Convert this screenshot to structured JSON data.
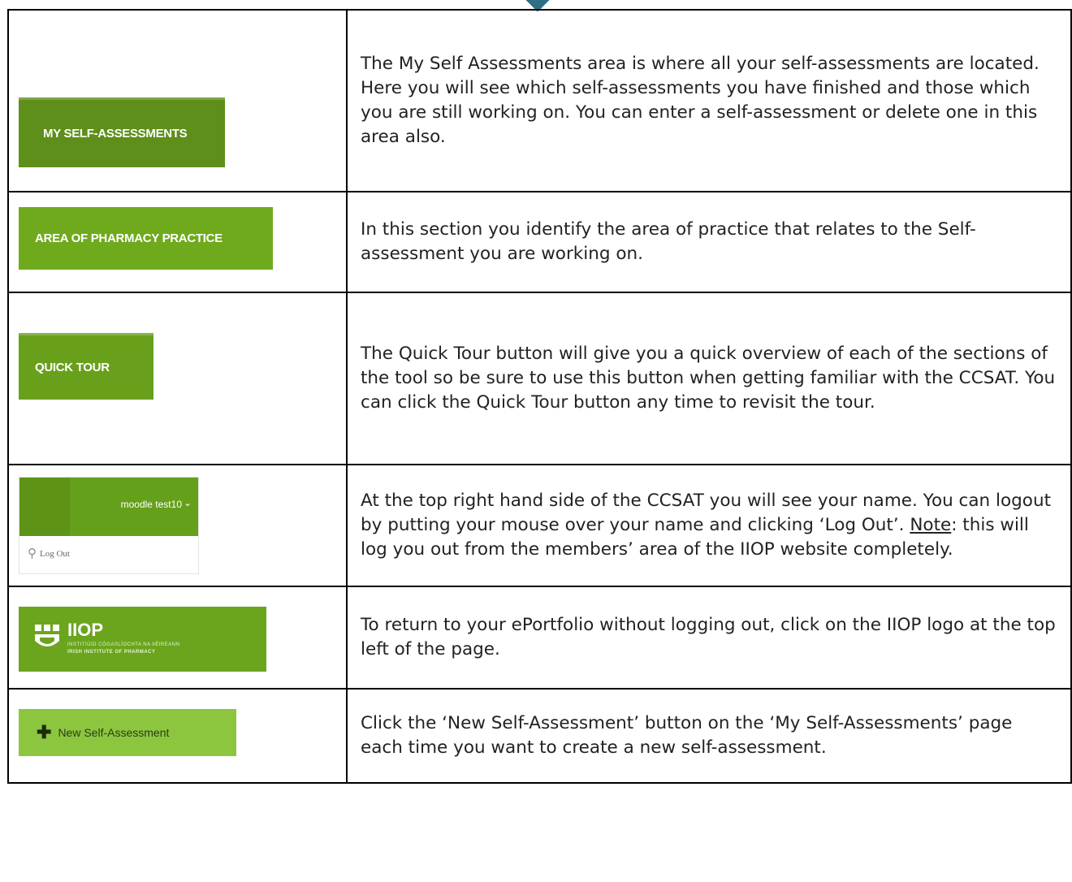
{
  "rows": [
    {
      "button_label": "MY SELF-ASSESSMENTS",
      "description": "The My Self Assessments area is where all your self-assessments are located. Here you will see which self-assessments you have finished and those which you are still working on. You can enter a self-assessment or delete one in this area also."
    },
    {
      "button_label": "AREA OF PHARMACY PRACTICE",
      "description": "In this section you identify the area of practice that relates to the Self-assessment you are working on."
    },
    {
      "button_label": "QUICK TOUR",
      "description": "The Quick Tour button will give you a quick overview of each of the sections of the tool so be sure to use this button when getting familiar with the CCSAT.  You can click the Quick Tour button any time to revisit the tour."
    },
    {
      "username": "moodle test10",
      "chevron_icon": "chevron-down-icon",
      "logout_icon": "key-icon",
      "logout_label": "Log Out",
      "description": "At the top right hand side of the CCSAT you will see your name. You can logout by putting your mouse over your name and clicking ‘Log Out’.",
      "note_label": "Note",
      "note_text": ": this will log you out from the members’ area of the IIOP website completely."
    },
    {
      "logo_text": "IIOP",
      "logo_sub1": "INSTITIÚID CÓGASLÍOCHTA NA hÉIREANN",
      "logo_sub2": "IRISH INSTITUTE OF PHARMACY",
      "description": "To return to your ePortfolio without logging out, click on the IIOP logo at the top left of the page."
    },
    {
      "button_icon": "plus-icon",
      "button_label": "New Self-Assessment",
      "description": "Click the ‘New Self-Assessment’ button on the ‘My Self-Assessments’ page each time you want to create a new self-assessment."
    }
  ],
  "colors": {
    "accent_green": "#6aa51d",
    "dark_green": "#5e8f1a",
    "light_green": "#8cc63f",
    "diamond": "#2e6f86"
  }
}
